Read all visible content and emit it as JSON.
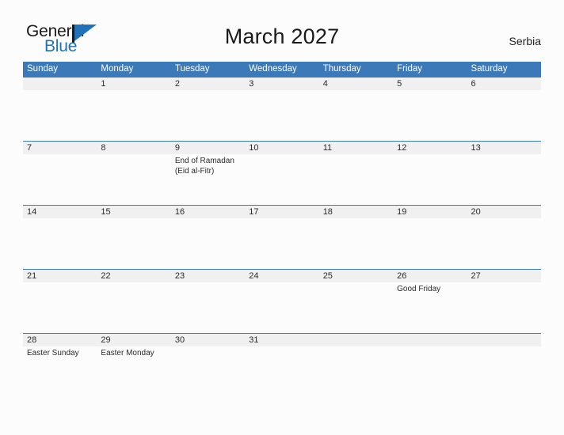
{
  "brand": {
    "name_part1": "General",
    "name_part2": "Blue",
    "flag_icon": "flag-triangle-icon",
    "accent_color": "#2272b8"
  },
  "header": {
    "title": "March 2027",
    "country": "Serbia"
  },
  "theme": {
    "header_bar_color": "#3b79b8",
    "date_strip_color": "#f0f0f0",
    "page_background": "#fcfcfc",
    "text_color": "#2b2b2b"
  },
  "calendar": {
    "month": "March",
    "year": "2027",
    "weekdays": [
      "Sunday",
      "Monday",
      "Tuesday",
      "Wednesday",
      "Thursday",
      "Friday",
      "Saturday"
    ],
    "weeks": [
      [
        {
          "date": "",
          "events": []
        },
        {
          "date": "1",
          "events": []
        },
        {
          "date": "2",
          "events": []
        },
        {
          "date": "3",
          "events": []
        },
        {
          "date": "4",
          "events": []
        },
        {
          "date": "5",
          "events": []
        },
        {
          "date": "6",
          "events": []
        }
      ],
      [
        {
          "date": "7",
          "events": []
        },
        {
          "date": "8",
          "events": []
        },
        {
          "date": "9",
          "events": [
            "End of Ramadan",
            "(Eid al-Fitr)"
          ]
        },
        {
          "date": "10",
          "events": []
        },
        {
          "date": "11",
          "events": []
        },
        {
          "date": "12",
          "events": []
        },
        {
          "date": "13",
          "events": []
        }
      ],
      [
        {
          "date": "14",
          "events": []
        },
        {
          "date": "15",
          "events": []
        },
        {
          "date": "16",
          "events": []
        },
        {
          "date": "17",
          "events": []
        },
        {
          "date": "18",
          "events": []
        },
        {
          "date": "19",
          "events": []
        },
        {
          "date": "20",
          "events": []
        }
      ],
      [
        {
          "date": "21",
          "events": []
        },
        {
          "date": "22",
          "events": []
        },
        {
          "date": "23",
          "events": []
        },
        {
          "date": "24",
          "events": []
        },
        {
          "date": "25",
          "events": []
        },
        {
          "date": "26",
          "events": [
            "Good Friday"
          ]
        },
        {
          "date": "27",
          "events": []
        }
      ],
      [
        {
          "date": "28",
          "events": [
            "Easter Sunday"
          ]
        },
        {
          "date": "29",
          "events": [
            "Easter Monday"
          ]
        },
        {
          "date": "30",
          "events": []
        },
        {
          "date": "31",
          "events": []
        },
        {
          "date": "",
          "events": []
        },
        {
          "date": "",
          "events": []
        },
        {
          "date": "",
          "events": []
        }
      ]
    ]
  }
}
